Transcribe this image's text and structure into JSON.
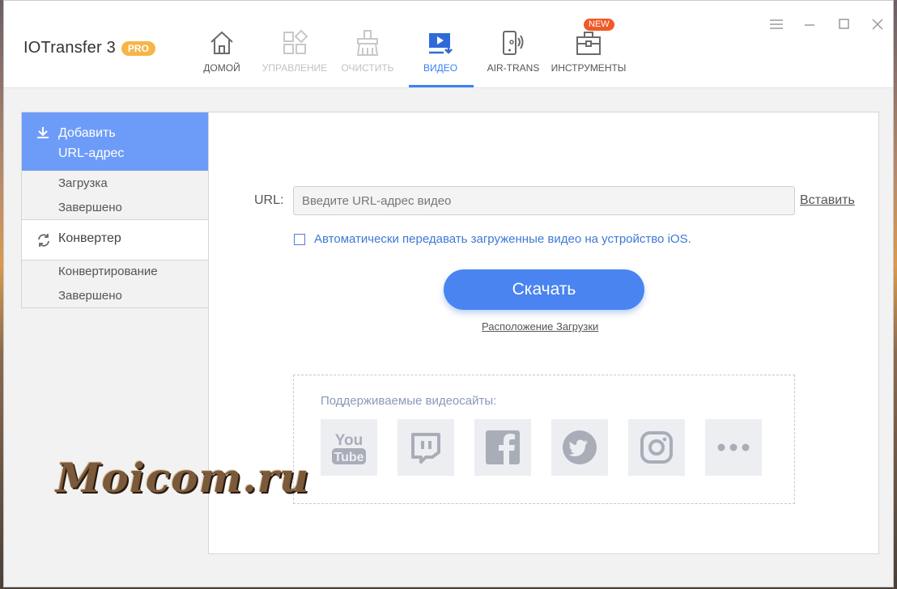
{
  "app": {
    "title": "IOTransfer 3",
    "badge": "PRO"
  },
  "nav": {
    "items": [
      {
        "label": "ДОМОЙ",
        "icon": "home-icon",
        "state": "normal"
      },
      {
        "label": "УПРАВЛЕНИЕ",
        "icon": "manage-icon",
        "state": "disabled"
      },
      {
        "label": "ОЧИСТИТЬ",
        "icon": "clean-icon",
        "state": "disabled"
      },
      {
        "label": "ВИДЕО",
        "icon": "video-icon",
        "state": "active"
      },
      {
        "label": "AIR-TRANS",
        "icon": "air-trans-icon",
        "state": "normal"
      },
      {
        "label": "ИНСТРУМЕНТЫ",
        "icon": "toolbox-icon",
        "state": "normal"
      }
    ],
    "new_badge": "NEW"
  },
  "sidebar": {
    "add_url_line1": "Добавить",
    "add_url_line2": "URL-адрес",
    "download": "Загрузка",
    "done1": "Завершено",
    "converter": "Конвертер",
    "converting": "Конвертирование",
    "done2": "Завершено"
  },
  "main": {
    "url_label": "URL:",
    "url_placeholder": "Введите URL-адрес видео",
    "paste": "Вставить",
    "auto_transfer": "Автоматически передавать загруженные видео на устройство iOS.",
    "auto_transfer_checked": false,
    "download_button": "Скачать",
    "download_location": "Расположение Загрузки",
    "supported_title": "Поддерживаемые видеосайты:",
    "sites": [
      "youtube-icon",
      "twitch-icon",
      "facebook-icon",
      "twitter-icon",
      "instagram-icon",
      "more-icon"
    ]
  },
  "watermark": "Moicom.ru",
  "colors": {
    "accent": "#4a84f0",
    "sidebar_active": "#6d9cf8",
    "pro_badge": "#f5b548",
    "new_badge": "#f05a28"
  }
}
